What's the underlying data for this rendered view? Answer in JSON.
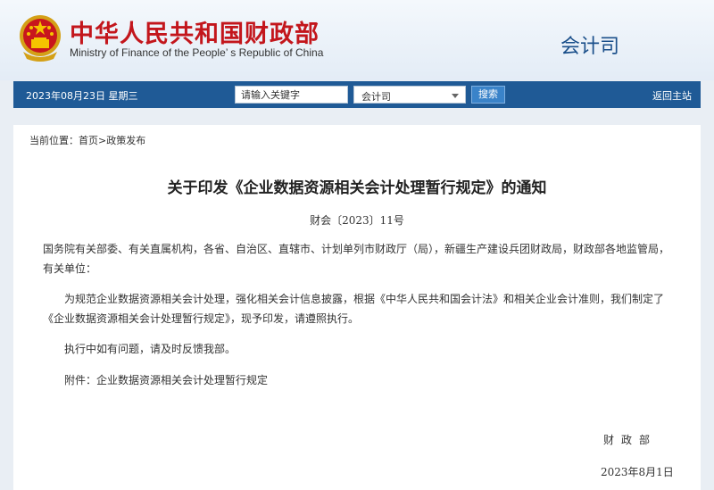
{
  "header": {
    "title": "中华人民共和国财政部",
    "subtitle": "Ministry of Finance of the People’ s Republic of China",
    "department": "会计司"
  },
  "navbar": {
    "date": "2023年08月23日  星期三",
    "search_placeholder": "请输入关键字",
    "department_selected": "会计司",
    "search_button": "搜索",
    "home_link": "返回主站"
  },
  "breadcrumb": "当前位置：首页>政策发布",
  "article": {
    "title": "关于印发《企业数据资源相关会计处理暂行规定》的通知",
    "doc_number": "财会〔2023〕11号",
    "paragraphs": [
      "国务院有关部委、有关直属机构，各省、自治区、直辖市、计划单列市财政厅（局），新疆生产建设兵团财政局，财政部各地监管局，有关单位：",
      "为规范企业数据资源相关会计处理，强化相关会计信息披露，根据《中华人民共和国会计法》和相关企业会计准则，我们制定了《企业数据资源相关会计处理暂行规定》，现予印发，请遵照执行。",
      "执行中如有问题，请及时反馈我部。",
      "附件：企业数据资源相关会计处理暂行规定"
    ],
    "signer": "财政部",
    "date": "2023年8月1日"
  },
  "colors": {
    "brand_red": "#c3161c",
    "nav_blue": "#1f5a96",
    "button_blue": "#3a83c9"
  },
  "icons": {
    "emblem": "national-emblem-icon",
    "dropdown": "chevron-down-icon"
  }
}
